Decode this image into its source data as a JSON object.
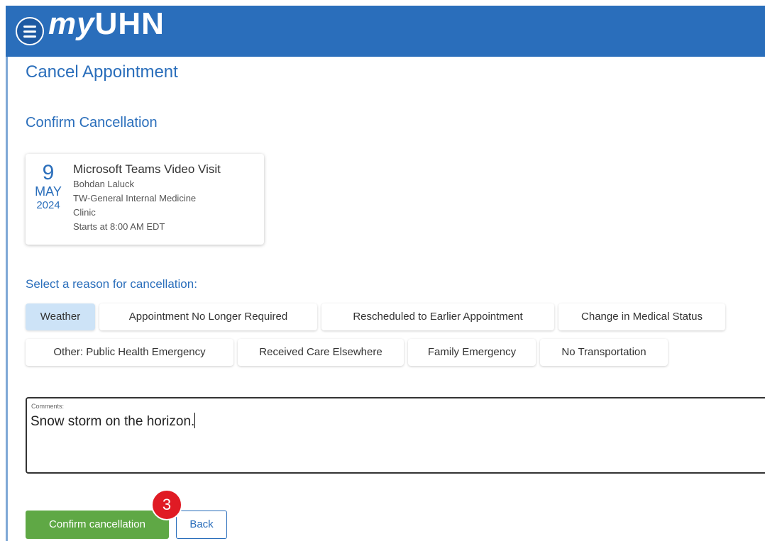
{
  "header": {
    "logo_my": "my",
    "logo_uhn": "UHN",
    "menu_icon": "hamburger-menu-icon"
  },
  "page": {
    "title": "Cancel Appointment",
    "section_title": "Confirm Cancellation"
  },
  "appointment": {
    "day": "9",
    "month": "MAY",
    "year": "2024",
    "type": "Microsoft Teams Video Visit",
    "provider": "Bohdan Laluck",
    "department": "TW-General Internal Medicine",
    "location": "Clinic",
    "start_time": "Starts at 8:00 AM EDT"
  },
  "reasons": {
    "label": "Select a reason for cancellation:",
    "selected": "Weather",
    "options": [
      "Weather",
      "Appointment No Longer Required",
      "Rescheduled to Earlier Appointment",
      "Change in Medical Status",
      "Other: Public Health Emergency",
      "Received Care Elsewhere",
      "Family Emergency",
      "No Transportation"
    ]
  },
  "comments": {
    "label": "Comments:",
    "value": "Snow storm on the horizon."
  },
  "actions": {
    "confirm_label": "Confirm cancellation",
    "back_label": "Back"
  },
  "annotation": {
    "step_number": "3"
  },
  "colors": {
    "header_blue": "#2a6ebb",
    "selected_chip": "#cde3f7",
    "confirm_green": "#5fa845",
    "badge_red": "#e01b24"
  }
}
